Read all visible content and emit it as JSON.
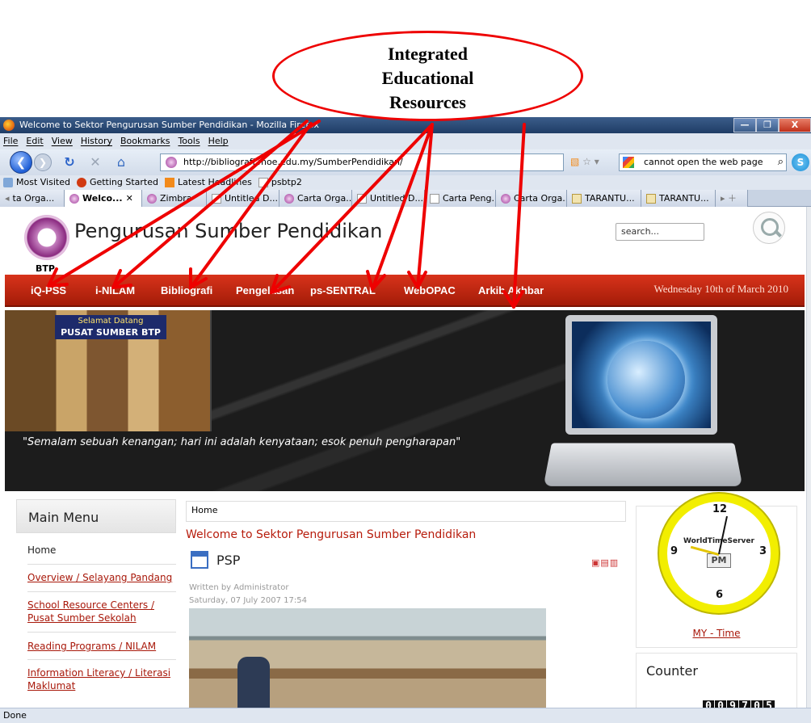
{
  "annotation": {
    "lines": [
      "Integrated",
      "Educational",
      "Resources"
    ]
  },
  "window": {
    "title": "Welcome to Sektor Pengurusan Sumber Pendidikan - Mozilla Firefox",
    "buttons": [
      "—",
      "❐",
      "X"
    ]
  },
  "menubar": [
    "File",
    "Edit",
    "View",
    "History",
    "Bookmarks",
    "Tools",
    "Help"
  ],
  "navbar": {
    "url": "http://bibliografi.moe.edu.my/SumberPendidikan/",
    "search_value": "cannot open the web page"
  },
  "bookmarks": [
    "Most Visited",
    "Getting Started",
    "Latest Headlines",
    "psbtp2"
  ],
  "tabs": [
    {
      "label": "ta Orga...",
      "icon": "doc-icon"
    },
    {
      "label": "Welco...",
      "icon": "site-icon",
      "active": true
    },
    {
      "label": "Zimbra",
      "icon": "site-icon"
    },
    {
      "label": "Untitled D...",
      "icon": "doc-icon"
    },
    {
      "label": "Carta Orga...",
      "icon": "site-icon"
    },
    {
      "label": "Untitled D...",
      "icon": "doc-icon"
    },
    {
      "label": "Carta Peng...",
      "icon": "doc-icon"
    },
    {
      "label": "Carta Orga...",
      "icon": "site-icon"
    },
    {
      "label": "TARANTU...",
      "icon": "tarantula-icon"
    },
    {
      "label": "TARANTU...",
      "icon": "tarantula-icon"
    }
  ],
  "site": {
    "logo_text": "BTP",
    "title": "Pengurusan Sumber Pendidikan",
    "search_placeholder": "search..."
  },
  "mainnav": {
    "items": [
      "iQ-PSS",
      "i-NILAM",
      "Bibliografi",
      "Pengelasan",
      "ps-SENTRAL",
      "WebOPAC",
      "Arkib Akhbar"
    ],
    "date": "Wednesday 10th of March 2010"
  },
  "banner": {
    "sign_line1": "Selamat Datang",
    "sign_line2": "PUSAT SUMBER BTP",
    "quote": "\"Semalam sebuah kenangan; hari ini adalah kenyataan; esok penuh pengharapan\""
  },
  "left_menu": {
    "title": "Main Menu",
    "items": [
      "Home",
      "Overview / Selayang Pandang",
      "School Resource Centers / Pusat Sumber Sekolah",
      "Reading Programs / NILAM",
      "Information Literacy / Literasi Maklumat"
    ]
  },
  "article": {
    "breadcrumb": "Home",
    "title": "Welcome to Sektor Pengurusan Sumber Pendidikan",
    "heading": "PSP",
    "author": "Written by Administrator",
    "date": "Saturday, 07 July 2007 17:54"
  },
  "clock": {
    "brand": "WorldTimeServer",
    "ampm": "PM",
    "numbers": [
      "12",
      "3",
      "6",
      "9"
    ],
    "link": "MY - Time"
  },
  "counter": {
    "title": "Counter",
    "digits": [
      "0",
      "0",
      "9",
      "7",
      "0",
      "5"
    ]
  },
  "statusbar": {
    "text": "Done"
  }
}
